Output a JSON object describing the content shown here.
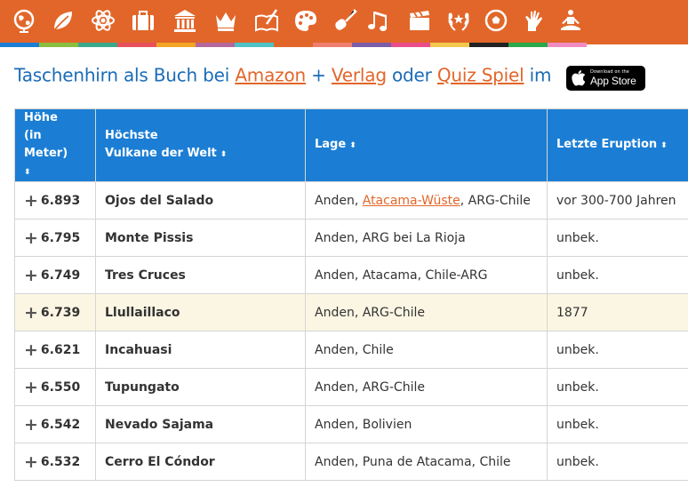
{
  "nav": {
    "icons": [
      "globe-icon",
      "leaf-icon",
      "atom-icon",
      "briefcase-icon",
      "temple-icon",
      "crown-icon",
      "book-quill-icon",
      "palette-icon",
      "guitar-icon",
      "music-notes-icon",
      "clapperboard-icon",
      "laurel-wreath-icon",
      "soccer-ball-icon",
      "hand-icon",
      "meditation-icon"
    ],
    "strip_colors": [
      "#1b7ed4",
      "#8cbd3f",
      "#3ca88b",
      "#e8505b",
      "#f3a524",
      "#b4689c",
      "#4fc2c6",
      "#e2662a",
      "#f07e6e",
      "#7b5ea7",
      "#e94e8a",
      "#f2c94c",
      "#222222",
      "#2aa84a",
      "#f08cc2"
    ]
  },
  "headline": {
    "prefix": "Taschenhirn als Buch bei",
    "amazon": "Amazon",
    "plus": "+",
    "verlag": "Verlag",
    "oder": "oder",
    "quiz": "Quiz Spiel",
    "im": "im",
    "appstore_small": "Download on the",
    "appstore_big": "App Store"
  },
  "table": {
    "headers": {
      "hoehe_line1": "Höhe",
      "hoehe_line2": "(in Meter)",
      "name_line1": "Höchste",
      "name_line2": "Vulkane der Welt",
      "lage": "Lage",
      "eruption": "Letzte Eruption"
    },
    "rows": [
      {
        "height": "6.893",
        "name": "Ojos del Salado",
        "lage_pre": "Anden, ",
        "lage_link": "Atacama-Wüste",
        "lage_post": ", ARG-Chile",
        "eruption": "vor 300-700 Jahren"
      },
      {
        "height": "6.795",
        "name": "Monte Pissis",
        "lage_pre": "Anden, ARG bei La Rioja",
        "lage_link": "",
        "lage_post": "",
        "eruption": "unbek."
      },
      {
        "height": "6.749",
        "name": "Tres Cruces",
        "lage_pre": "Anden, Atacama, Chile-ARG",
        "lage_link": "",
        "lage_post": "",
        "eruption": "unbek."
      },
      {
        "height": "6.739",
        "name": "Llullaillaco",
        "lage_pre": "Anden, ARG-Chile",
        "lage_link": "",
        "lage_post": "",
        "eruption": "1877"
      },
      {
        "height": "6.621",
        "name": "Incahuasi",
        "lage_pre": "Anden, Chile",
        "lage_link": "",
        "lage_post": "",
        "eruption": "unbek."
      },
      {
        "height": "6.550",
        "name": "Tupungato",
        "lage_pre": "Anden, ARG-Chile",
        "lage_link": "",
        "lage_post": "",
        "eruption": "unbek."
      },
      {
        "height": "6.542",
        "name": "Nevado Sajama",
        "lage_pre": "Anden, Bolivien",
        "lage_link": "",
        "lage_post": "",
        "eruption": "unbek."
      },
      {
        "height": "6.532",
        "name": "Cerro El Cóndor",
        "lage_pre": "Anden, Puna de Atacama, Chile",
        "lage_link": "",
        "lage_post": "",
        "eruption": "unbek."
      }
    ]
  }
}
